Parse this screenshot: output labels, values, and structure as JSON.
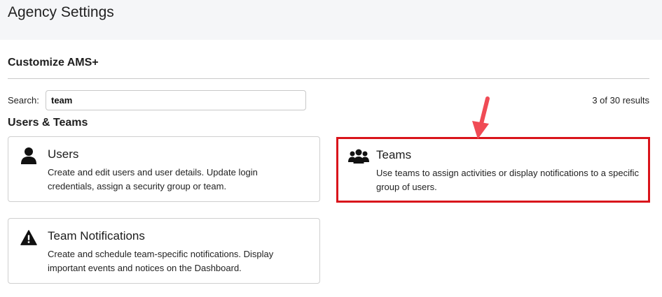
{
  "header": {
    "title": "Agency Settings"
  },
  "section": {
    "title": "Customize AMS+"
  },
  "search": {
    "label": "Search:",
    "value": "team",
    "results": "3 of 30 results"
  },
  "group": {
    "title": "Users & Teams"
  },
  "cards": [
    {
      "title": "Users",
      "icon": "user-icon",
      "description": "Create and edit users and user details. Update login credentials, assign a security group or team."
    },
    {
      "title": "Teams",
      "icon": "group-icon",
      "description": "Use teams to assign activities or display notifications to a specific group of users."
    },
    {
      "title": "Team Notifications",
      "icon": "warning-icon",
      "description": "Create and schedule team-specific notifications. Display important events and notices on the Dashboard."
    }
  ],
  "colors": {
    "highlight": "#d9141b",
    "arrow": "#f04b55",
    "header_bg": "#f5f6f8"
  }
}
